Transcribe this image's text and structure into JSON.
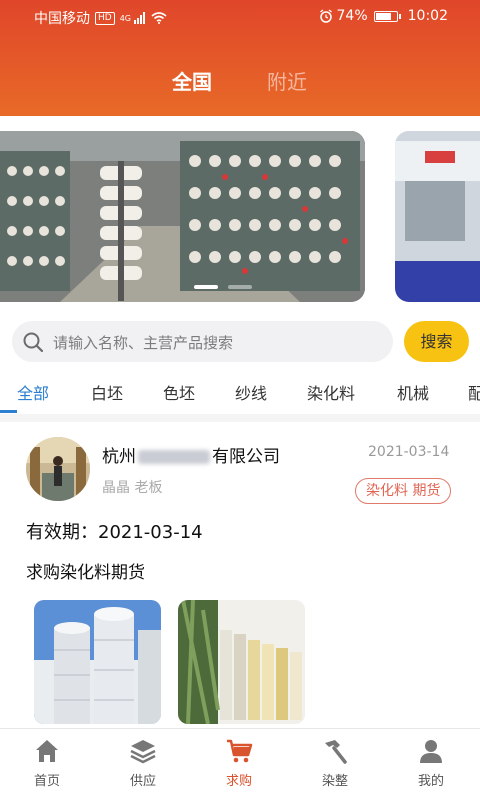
{
  "status_bar": {
    "carrier": "中国移动",
    "hd": "HD",
    "network": "4G",
    "battery": "74%",
    "time": "10:02"
  },
  "top_tabs": {
    "national": "全国",
    "nearby": "附近",
    "active": "national"
  },
  "banner": {
    "active_dot": 0,
    "dot_count": 3
  },
  "search": {
    "placeholder": "请输入名称、主营产品搜索",
    "button": "搜索"
  },
  "categories": {
    "items": [
      "全部",
      "白坯",
      "色坯",
      "纱线",
      "染化料",
      "机械",
      "配"
    ],
    "active_index": 0
  },
  "post": {
    "company_prefix": "杭州",
    "company_suffix": "有限公司",
    "date": "2021-03-14",
    "contact": "晶晶 老板",
    "tag": "染化料 期货",
    "validity": "有效期：2021-03-14",
    "demand": "求购染化料期货"
  },
  "bottom_nav": {
    "items": [
      "首页",
      "供应",
      "求购",
      "染整",
      "我的"
    ],
    "active_index": 2
  },
  "colors": {
    "header_top": "#e0462a",
    "header_bottom": "#e86a28",
    "search_button": "#f7c211",
    "active_category": "#2c7fd0",
    "active_nav": "#d9532f",
    "tag": "#e06553"
  }
}
